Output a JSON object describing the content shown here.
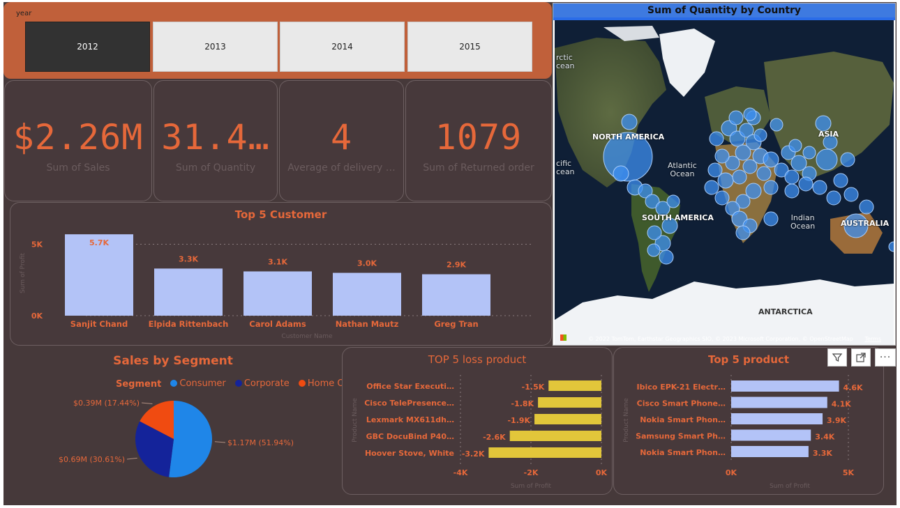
{
  "slicer": {
    "title": "year",
    "options": [
      "2012",
      "2013",
      "2014",
      "2015"
    ],
    "selected": "2012"
  },
  "kpis": [
    {
      "value": "$2.26M",
      "label": "Sum of Sales"
    },
    {
      "value": "31.4…",
      "label": "Sum of Quantity"
    },
    {
      "value": "4",
      "label": "Average of delivery …"
    },
    {
      "value": "1079",
      "label": "Sum of Returned order"
    }
  ],
  "map": {
    "title": "Sum of Quantity by Country",
    "labels": {
      "north_america": "NORTH AMERICA",
      "south_america": "SOUTH AMERICA",
      "asia": "ASIA",
      "australia": "AUSTRALIA",
      "antarctica": "ANTARCTICA",
      "atlantic": "Atlantic\nOcean",
      "indian": "Indian\nOcean",
      "arctic": "rctic\ncean",
      "pacific": "cific\ncean"
    },
    "attribution": "© 2022 TomTom, Earthstar Geographics SIO, © 2023 Microsoft Corporation, © OpenStreetMap",
    "terms": "Terms",
    "brand": "Microsoft"
  },
  "colors": {
    "accent": "#e6683a",
    "bar_blue": "#b3c3f7",
    "bar_yellow": "#e2c63a",
    "consumer": "#1f86e8",
    "corporate": "#14239a",
    "home_office": "#f04b11"
  },
  "chart_data": [
    {
      "type": "bar",
      "title": "Top 5 Customer",
      "xlabel": "Customer Name",
      "ylabel": "Sum of Profit",
      "categories": [
        "Sanjit Chand",
        "Elpida Rittenbach",
        "Carol Adams",
        "Nathan Mautz",
        "Greg Tran"
      ],
      "values": [
        5700,
        3300,
        3100,
        3000,
        2900
      ],
      "data_labels": [
        "5.7K",
        "3.3K",
        "3.1K",
        "3.0K",
        "2.9K"
      ],
      "ylim": [
        0,
        6100
      ],
      "yticks": [
        0,
        5000
      ],
      "ytick_labels": [
        "0K",
        "5K"
      ],
      "grid": true
    },
    {
      "type": "pie",
      "title": "Sales by Segment",
      "legend_title": "Segment",
      "labels": [
        "Consumer",
        "Corporate",
        "Home Office"
      ],
      "values": [
        1.17,
        0.69,
        0.39
      ],
      "percents": [
        51.94,
        30.61,
        17.44
      ],
      "data_labels": [
        "$1.17M (51.94%)",
        "$0.69M (30.61%)",
        "$0.39M (17.44%)"
      ],
      "legend": "top"
    },
    {
      "type": "bar",
      "orientation": "horizontal",
      "title": "TOP 5 loss product",
      "xlabel": "Sum of Profit",
      "ylabel": "Product Name",
      "categories": [
        "Office Star Executi…",
        "Cisco TelePresence…",
        "Lexmark MX611dh…",
        "GBC DocuBind P40…",
        "Hoover Stove, White"
      ],
      "values": [
        -1500,
        -1800,
        -1900,
        -2600,
        -3200
      ],
      "data_labels": [
        "-1.5K",
        "-1.8K",
        "-1.9K",
        "-2.6K",
        "-3.2K"
      ],
      "xlim": [
        -4000,
        0
      ],
      "xticks": [
        -4000,
        -2000,
        0
      ],
      "xtick_labels": [
        "-4K",
        "-2K",
        "0K"
      ],
      "grid": true
    },
    {
      "type": "bar",
      "orientation": "horizontal",
      "title": "Top 5 product",
      "xlabel": "Sum of Profit",
      "ylabel": "Product Name",
      "categories": [
        "Ibico EPK-21 Electr…",
        "Cisco Smart Phone…",
        "Nokia Smart Phon…",
        "Samsung Smart Ph…",
        "Nokia Smart Phon…"
      ],
      "values": [
        4600,
        4100,
        3900,
        3400,
        3300
      ],
      "data_labels": [
        "4.6K",
        "4.1K",
        "3.9K",
        "3.4K",
        "3.3K"
      ],
      "xlim": [
        0,
        5000
      ],
      "xticks": [
        0,
        5000
      ],
      "xtick_labels": [
        "0K",
        "5K"
      ],
      "grid": true
    }
  ]
}
